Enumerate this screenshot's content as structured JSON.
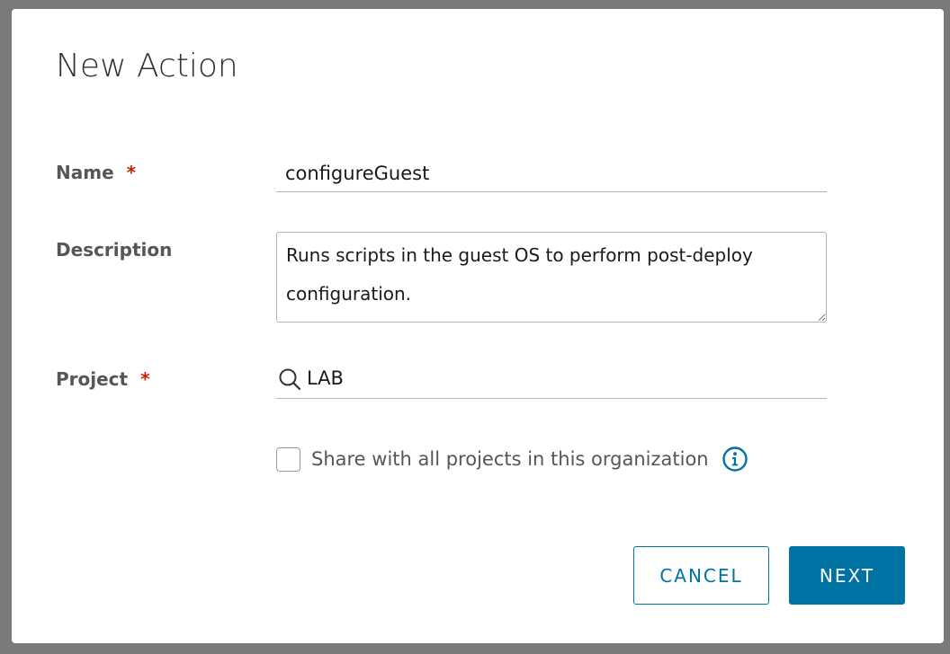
{
  "modal": {
    "title": "New Action"
  },
  "form": {
    "name": {
      "label": "Name",
      "required_mark": "*",
      "value": "configureGuest"
    },
    "description": {
      "label": "Description",
      "value": "Runs scripts in the guest OS to perform post-deploy configuration."
    },
    "project": {
      "label": "Project",
      "required_mark": "*",
      "value": "LAB",
      "icon": "search-icon"
    },
    "share": {
      "label": "Share with all projects in this organization",
      "checked": false,
      "icon": "info-icon"
    }
  },
  "buttons": {
    "cancel_label": "CANCEL",
    "next_label": "NEXT"
  },
  "colors": {
    "primary": "#0072a3",
    "required": "#c92100",
    "label": "#565656"
  }
}
